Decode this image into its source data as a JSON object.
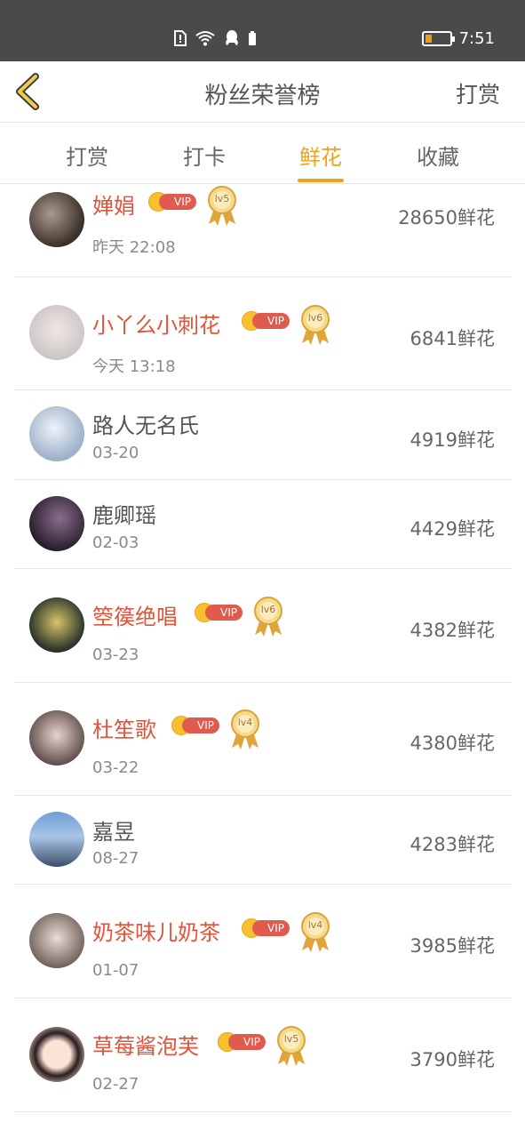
{
  "status_bar": {
    "time": "7:51",
    "icons": [
      "sim-alert-icon",
      "wifi-icon",
      "qq-icon",
      "battery-saver-icon",
      "battery-icon"
    ]
  },
  "header": {
    "back_icon": "chevron-left-icon",
    "title": "粉丝荣誉榜",
    "right_action": "打赏"
  },
  "tabs": [
    {
      "label": "打赏",
      "active": false
    },
    {
      "label": "打卡",
      "active": false
    },
    {
      "label": "鲜花",
      "active": true
    },
    {
      "label": "收藏",
      "active": false
    }
  ],
  "colors": {
    "accent": "#f0a21c",
    "vip_name": "#e2533c",
    "vip_badge": "#e05a4e",
    "status_bar": "#4a4a4a"
  },
  "list": [
    {
      "name": "婵娟",
      "time": "昨天 22:08",
      "amount": "28650鲜花",
      "vip": true,
      "level": "lv5"
    },
    {
      "name": "小丫么小刺花",
      "time": "今天 13:18",
      "amount": "6841鲜花",
      "vip": true,
      "level": "lv6"
    },
    {
      "name": "路人无名氏",
      "time": "03-20",
      "amount": "4919鲜花",
      "vip": false,
      "level": ""
    },
    {
      "name": "鹿卿瑶",
      "time": "02-03",
      "amount": "4429鲜花",
      "vip": false,
      "level": ""
    },
    {
      "name": "箜篌绝唱",
      "time": "03-23",
      "amount": "4382鲜花",
      "vip": true,
      "level": "lv6"
    },
    {
      "name": "杜笙歌",
      "time": "03-22",
      "amount": "4380鲜花",
      "vip": true,
      "level": "lv4"
    },
    {
      "name": "嘉昱",
      "time": "08-27",
      "amount": "4283鲜花",
      "vip": false,
      "level": ""
    },
    {
      "name": "奶茶味儿奶茶",
      "time": "01-07",
      "amount": "3985鲜花",
      "vip": true,
      "level": "lv4"
    },
    {
      "name": "草莓酱泡芙",
      "time": "02-27",
      "amount": "3790鲜花",
      "vip": true,
      "level": "lv5"
    }
  ],
  "vip_label": "VIP"
}
